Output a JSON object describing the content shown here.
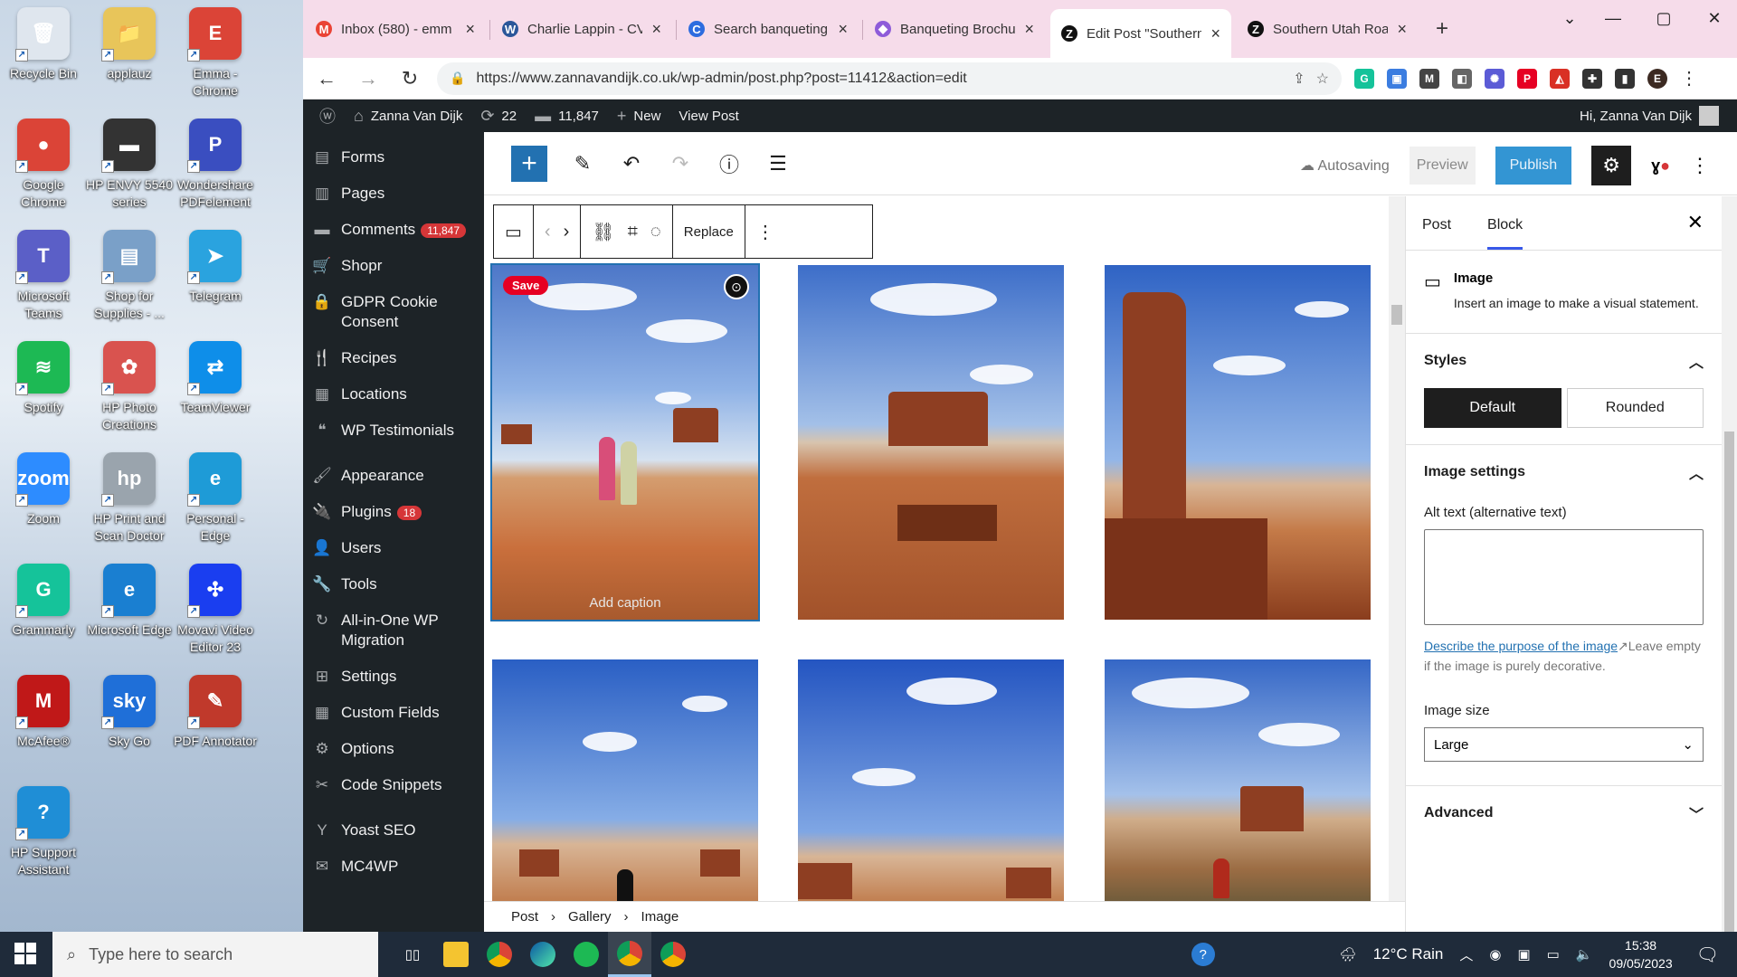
{
  "desktop": {
    "icons": [
      {
        "label": "Recycle Bin",
        "glyph": "🗑",
        "color": "#dfe6ee"
      },
      {
        "label": "applauz",
        "glyph": "📁",
        "color": "#e8c55a"
      },
      {
        "label": "Emma - Chrome",
        "glyph": "E",
        "color": "#db4437"
      },
      {
        "label": "Google Chrome",
        "glyph": "●",
        "color": "#db4437"
      },
      {
        "label": "HP ENVY 5540 series",
        "glyph": "▬",
        "color": "#333"
      },
      {
        "label": "Wondershare PDFelement",
        "glyph": "P",
        "color": "#3a4ec0"
      },
      {
        "label": "Microsoft Teams",
        "glyph": "T",
        "color": "#5b5fc7"
      },
      {
        "label": "Shop for Supplies - ...",
        "glyph": "▤",
        "color": "#7aa0c8"
      },
      {
        "label": "Telegram",
        "glyph": "➤",
        "color": "#2aa3df"
      },
      {
        "label": "Spotify",
        "glyph": "≋",
        "color": "#1db954"
      },
      {
        "label": "HP Photo Creations",
        "glyph": "✿",
        "color": "#d9534f"
      },
      {
        "label": "TeamViewer",
        "glyph": "⇄",
        "color": "#0e8ee9"
      },
      {
        "label": "Zoom",
        "glyph": "zoom",
        "color": "#2d8cff"
      },
      {
        "label": "HP Print and Scan Doctor",
        "glyph": "hp",
        "color": "#9aa4ad"
      },
      {
        "label": "Personal - Edge",
        "glyph": "e",
        "color": "#1e9bd7"
      },
      {
        "label": "Grammarly",
        "glyph": "G",
        "color": "#15c39a"
      },
      {
        "label": "Microsoft Edge",
        "glyph": "e",
        "color": "#1a7fd1"
      },
      {
        "label": "Movavi Video Editor 23",
        "glyph": "✣",
        "color": "#1a3ef0"
      },
      {
        "label": "McAfee®",
        "glyph": "M",
        "color": "#c01818"
      },
      {
        "label": "Sky Go",
        "glyph": "sky",
        "color": "#1f6fd8"
      },
      {
        "label": "PDF Annotator",
        "glyph": "✎",
        "color": "#c0392b"
      },
      {
        "label": "HP Support Assistant",
        "glyph": "?",
        "color": "#1f8ed6"
      }
    ]
  },
  "browser": {
    "tabs": [
      {
        "title": "Inbox (580) - emm",
        "fav": "M",
        "color": "#ea4335"
      },
      {
        "title": "Charlie Lappin - CV",
        "fav": "W",
        "color": "#2b579a"
      },
      {
        "title": "Search banqueting",
        "fav": "C",
        "color": "#2d6cdf"
      },
      {
        "title": "Banqueting Brochu",
        "fav": "◆",
        "color": "#8e5cd9"
      },
      {
        "title": "Edit Post \"Southern",
        "fav": "Z",
        "color": "#111"
      },
      {
        "title": "Southern Utah Roa",
        "fav": "Z",
        "color": "#111"
      }
    ],
    "url": "https://www.zannavandijk.co.uk/wp-admin/post.php?post=11412&action=edit",
    "extensions": [
      {
        "label": "G",
        "color": "#15c39a"
      },
      {
        "label": "▣",
        "color": "#3b7de0"
      },
      {
        "label": "M",
        "color": "#444"
      },
      {
        "label": "◧",
        "color": "#666"
      },
      {
        "label": "✺",
        "color": "#5b5bd6"
      },
      {
        "label": "P",
        "color": "#e60023"
      },
      {
        "label": "◭",
        "color": "#d93025"
      },
      {
        "label": "✚",
        "color": "#333"
      },
      {
        "label": "▮",
        "color": "#333"
      },
      {
        "label": "E",
        "color": "#3c2a22"
      }
    ]
  },
  "adminbar": {
    "site": "Zanna Van Dijk",
    "updates": "22",
    "comments": "11,847",
    "new": "New",
    "view": "View Post",
    "greeting": "Hi, Zanna Van Dijk"
  },
  "wpmenu": [
    {
      "label": "Forms",
      "icon": "▤"
    },
    {
      "label": "Pages",
      "icon": "▥"
    },
    {
      "label": "Comments",
      "icon": "▬",
      "badge": "11,847"
    },
    {
      "label": "Shopr",
      "icon": "🛒"
    },
    {
      "label": "GDPR Cookie Consent",
      "icon": "🔒"
    },
    {
      "label": "Recipes",
      "icon": "🍴"
    },
    {
      "label": "Locations",
      "icon": "▦"
    },
    {
      "label": "WP Testimonials",
      "icon": "❝"
    },
    {
      "label": "Appearance",
      "icon": "🖌",
      "gap": true
    },
    {
      "label": "Plugins",
      "icon": "🔌",
      "badge": "18"
    },
    {
      "label": "Users",
      "icon": "👤"
    },
    {
      "label": "Tools",
      "icon": "🔧"
    },
    {
      "label": "All-in-One WP Migration",
      "icon": "↻"
    },
    {
      "label": "Settings",
      "icon": "⊞"
    },
    {
      "label": "Custom Fields",
      "icon": "▦"
    },
    {
      "label": "Options",
      "icon": "⚙"
    },
    {
      "label": "Code Snippets",
      "icon": "✂"
    },
    {
      "label": "Yoast SEO",
      "icon": "Y",
      "gap": true
    },
    {
      "label": "MC4WP",
      "icon": "✉"
    }
  ],
  "editor": {
    "autosave": "Autosaving",
    "preview": "Preview",
    "publish": "Publish",
    "blocktoolbar": {
      "replace": "Replace"
    },
    "caption_placeholder": "Add caption",
    "pin_save": "Save",
    "breadcrumbs": [
      "Post",
      "Gallery",
      "Image"
    ]
  },
  "settings": {
    "tabs": [
      "Post",
      "Block"
    ],
    "block_title": "Image",
    "block_desc": "Insert an image to make a visual statement.",
    "styles_title": "Styles",
    "style_options": [
      "Default",
      "Rounded"
    ],
    "image_settings_title": "Image settings",
    "alt_label": "Alt text (alternative text)",
    "alt_link": "Describe the purpose of the image",
    "alt_help": "Leave empty if the image is purely decorative.",
    "size_label": "Image size",
    "size_value": "Large",
    "advanced_title": "Advanced"
  },
  "taskbar": {
    "search_placeholder": "Type here to search",
    "weather": "12°C  Rain",
    "time": "15:38",
    "date": "09/05/2023"
  }
}
